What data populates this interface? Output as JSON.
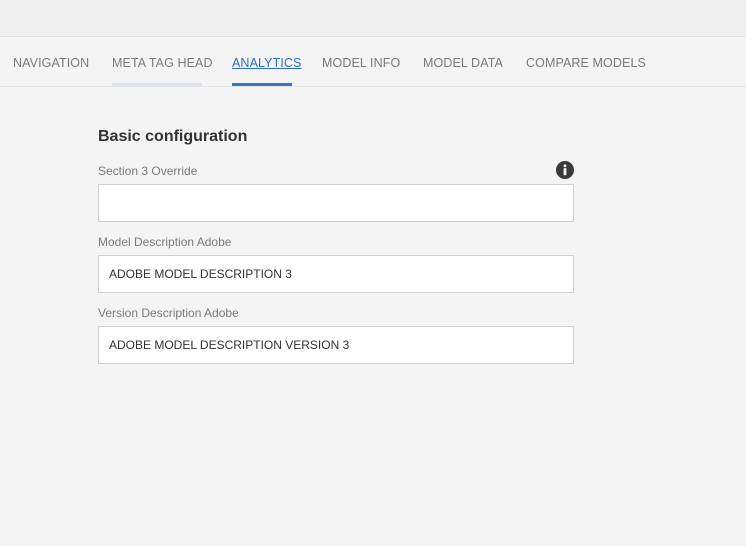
{
  "tabs": [
    {
      "label": "NAVIGATION"
    },
    {
      "label": "META TAG HEAD"
    },
    {
      "label": "ANALYTICS"
    },
    {
      "label": "MODEL INFO"
    },
    {
      "label": "MODEL DATA"
    },
    {
      "label": "COMPARE MODELS"
    }
  ],
  "active_tab": "ANALYTICS",
  "form": {
    "title": "Basic configuration",
    "fields": [
      {
        "label": "Section 3 Override",
        "value": ""
      },
      {
        "label": "Model Description Adobe",
        "value": "ADOBE MODEL DESCRIPTION 3"
      },
      {
        "label": "Version Description Adobe",
        "value": "ADOBE MODEL DESCRIPTION VERSION 3"
      }
    ]
  },
  "icons": {
    "info": "info-circle-icon"
  },
  "colors": {
    "accent": "#3b73c7",
    "background": "#f4f4f4"
  }
}
